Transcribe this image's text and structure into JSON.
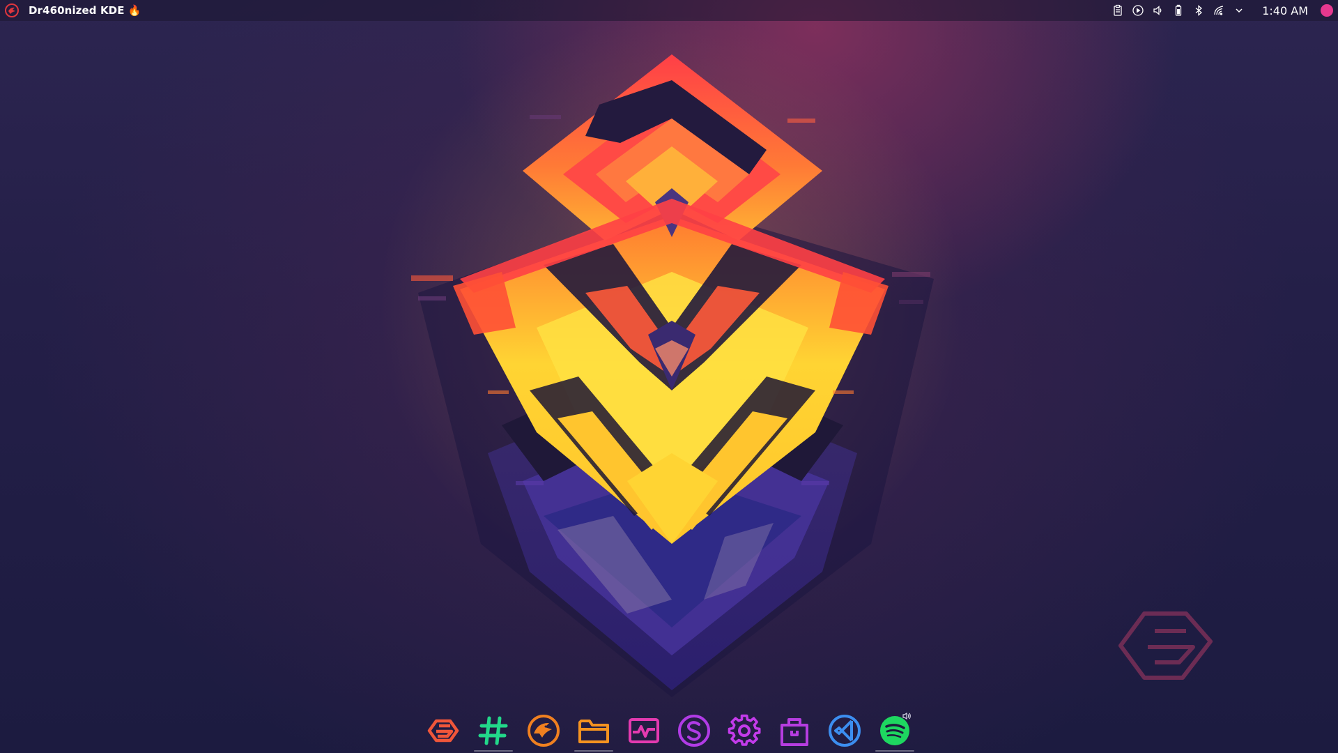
{
  "top_panel": {
    "launcher_icon": "garuda-dragon-icon",
    "window_title": "Dr460nized KDE 🔥",
    "tray": [
      {
        "icon": "clipboard-icon"
      },
      {
        "icon": "media-player-icon"
      },
      {
        "icon": "volume-icon"
      },
      {
        "icon": "battery-icon"
      },
      {
        "icon": "bluetooth-icon"
      },
      {
        "icon": "network-wifi-icon"
      },
      {
        "icon": "chevron-down-icon"
      }
    ],
    "clock": "1:40 AM",
    "user_indicator_color": "#e6388f"
  },
  "wallpaper": {
    "colors": {
      "yellow": "#ffd433",
      "orange": "#ff8a2b",
      "red": "#ff3d45",
      "purple": "#5a3aa8",
      "background": "#241f48"
    },
    "watermark_icon": "garuda-logo-icon"
  },
  "dock": {
    "items": [
      {
        "icon": "garuda-logo-icon",
        "color": "#f0563a",
        "running": false
      },
      {
        "icon": "hashtag-icon",
        "color": "#22d88a",
        "running": true
      },
      {
        "icon": "dragon-browser-icon",
        "color": "#f08020",
        "running": false
      },
      {
        "icon": "folder-icon",
        "color": "#f59320",
        "running": true
      },
      {
        "icon": "system-monitor-icon",
        "color": "#e43ab0",
        "running": false
      },
      {
        "icon": "s-circle-icon",
        "color": "#b13be6",
        "running": false
      },
      {
        "icon": "settings-gear-icon",
        "color": "#c33bea",
        "running": false
      },
      {
        "icon": "shopping-bag-icon",
        "color": "#b63de0",
        "running": false
      },
      {
        "icon": "code-editor-icon",
        "color": "#3c8ef0",
        "running": false
      },
      {
        "icon": "spotify-icon",
        "color": "#1ed760",
        "running": true,
        "badge_icon": "speaker-icon"
      }
    ]
  }
}
